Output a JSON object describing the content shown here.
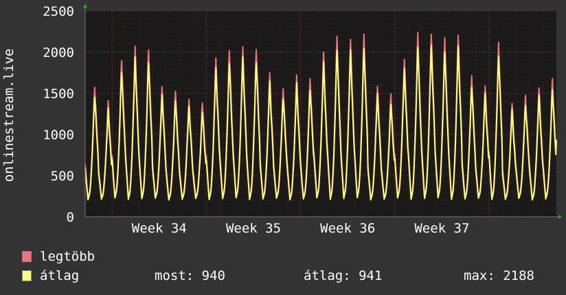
{
  "colors": {
    "background": "#333333",
    "plot_background": "#1a1a1a",
    "grid": "#4a1f1f",
    "max_series": "#f0727a",
    "avg_series": "#ffff80",
    "axis": "#777777",
    "arrow": "#00cc00"
  },
  "chart_data": {
    "type": "line",
    "ylabel": "onlinestream.live",
    "xlabel": "",
    "title": "",
    "ylim": [
      0,
      2500
    ],
    "yticks": [
      "0",
      "500",
      "1000",
      "1500",
      "2000",
      "2500"
    ],
    "xticks": [
      "Week 34",
      "Week 35",
      "Week 36",
      "Week 37"
    ],
    "grid": true,
    "legend_placement": "bottom",
    "days": 35,
    "daily_peaks_max": [
      1630,
      1410,
      1950,
      2100,
      2070,
      1610,
      1550,
      1460,
      1400,
      1970,
      2060,
      2100,
      2080,
      1770,
      1600,
      1740,
      1720,
      2030,
      2240,
      2200,
      2250,
      1630,
      1500,
      1970,
      2260,
      2280,
      2200,
      2260,
      1740,
      1620,
      2160,
      1400,
      1500,
      1600,
      1700
    ],
    "series": [
      {
        "name": "legtöbb",
        "peak_scale": 1.0,
        "trough": 210
      },
      {
        "name": "átlag",
        "peak_scale": 0.93,
        "trough": 190
      }
    ]
  },
  "legend": {
    "items": [
      {
        "label": "legtöbb"
      },
      {
        "label": "átlag"
      }
    ],
    "stats": {
      "most": "most: 940",
      "atlag": "átlag: 941",
      "max": "max: 2188"
    }
  }
}
